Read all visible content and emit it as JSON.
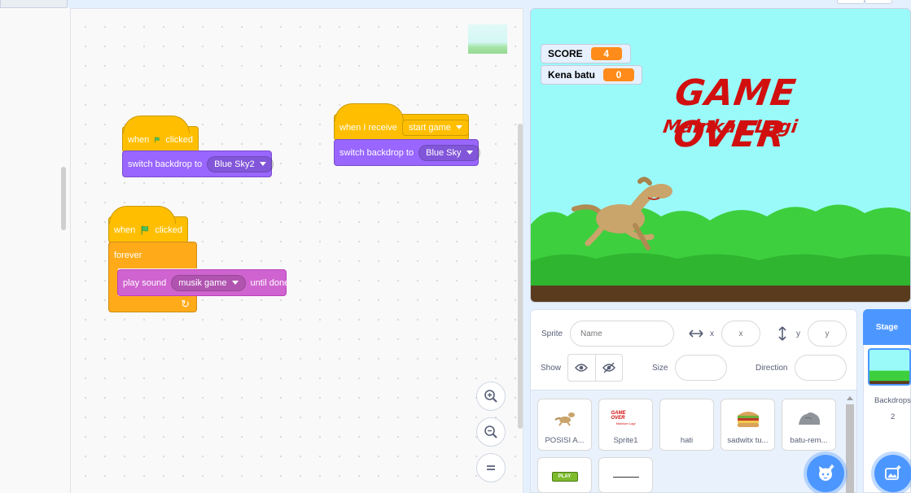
{
  "code_area": {
    "script1": {
      "hat_when": "when",
      "hat_clicked": "clicked",
      "switch_label": "switch backdrop to",
      "switch_value": "Blue Sky2"
    },
    "script2": {
      "hat_label": "when I receive",
      "hat_value": "start game",
      "switch_label": "switch backdrop to",
      "switch_value": "Blue Sky"
    },
    "script3": {
      "hat_when": "when",
      "hat_clicked": "clicked",
      "forever_label": "forever",
      "sound_label": "play sound",
      "sound_value": "musik game",
      "sound_suffix": "until done"
    },
    "zoom": {
      "in_icon": "zoom-in-icon",
      "out_icon": "zoom-out-icon",
      "reset_icon": "equals-icon"
    }
  },
  "stage": {
    "monitors": [
      {
        "label": "SCORE",
        "value": "4"
      },
      {
        "label": "Kena batu",
        "value": "0"
      }
    ],
    "title": "GAME OVER",
    "subtitle": "Mainkan Lagi",
    "colors": {
      "sky": "#9afafa",
      "hills": "#3ecf3e",
      "ground": "#5a3b1e",
      "title": "#d10f0f"
    }
  },
  "sprite_info": {
    "sprite_label": "Sprite",
    "name_placeholder": "Name",
    "x_label": "x",
    "x_placeholder": "x",
    "y_label": "y",
    "y_placeholder": "y",
    "show_label": "Show",
    "size_label": "Size",
    "direction_label": "Direction"
  },
  "sprites": [
    {
      "name": "POSISI A...",
      "icon": "dog-icon"
    },
    {
      "name": "Sprite1",
      "icon": "game-over-text-icon",
      "preview": "GAME OVER",
      "preview2": "Mainkan Lagi"
    },
    {
      "name": "hati",
      "icon": "blank-icon"
    },
    {
      "name": "sadwitx tu...",
      "icon": "sandwich-icon"
    },
    {
      "name": "batu-rem...",
      "icon": "rock-icon"
    },
    {
      "name": "",
      "icon": "play-button-icon",
      "preview": "PLAY"
    },
    {
      "name": "",
      "icon": "line-icon"
    }
  ],
  "stage_panel": {
    "header": "Stage",
    "backdrops_label": "Backdrops",
    "backdrops_count": "2"
  }
}
